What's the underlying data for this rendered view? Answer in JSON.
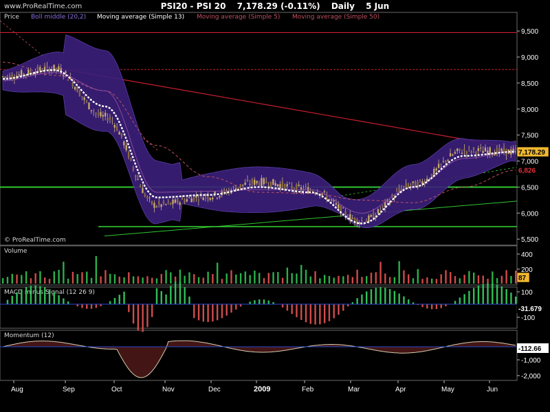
{
  "header": {
    "instrument": "PSI20 - PSI 20",
    "last": "7,178.29 (-0.11%)",
    "period": "Daily",
    "date": "5 Jun"
  },
  "watermark": {
    "top": "www.ProRealTime.com",
    "bottom": "© ProRealTime.com"
  },
  "colors": {
    "price_up": "#2db84a",
    "price_down": "#d34a4a",
    "boll_fill": "#3b1f7a",
    "boll_edge": "#6b4bc2",
    "ma13": "#ffffff",
    "ma5": "#c05060",
    "ma50": "#c05060",
    "horizontal_line": "#cc1f2f",
    "green_line": "#32c832",
    "volume_up": "#2bb04a",
    "volume_down": "#d04a4a",
    "macd_up": "#32c05a",
    "macd_down": "#d24c4c",
    "momentum_pos": "#1f4a17",
    "momentum_neg": "#4a1717",
    "momentum_line": "#d6d0b0",
    "axis_text": "#ffffff",
    "panel_label": "#d8d8d8"
  },
  "chart_data": [
    {
      "panel": "price",
      "type": "line",
      "legend": [
        "Price",
        "Boll middle (20,2)",
        "Moving average (Simple 13)",
        "Moving average (Simple 5)",
        "Moving average (Simple 50)"
      ],
      "x_labels": [
        "Aug",
        "Sep",
        "Oct",
        "Nov",
        "Dec",
        "2009",
        "Feb",
        "Mar",
        "Apr",
        "May",
        "Jun"
      ],
      "y_ticks": [
        "9,500",
        "9,000",
        "8,500",
        "8,000",
        "7,500",
        "7,000",
        "6,500",
        "6,000",
        "5,500"
      ],
      "ylim": [
        5450,
        9700
      ],
      "last_value": "7,178.29",
      "value_labels": [
        "6,826"
      ],
      "x": [
        "Aug",
        "Sep",
        "Oct",
        "Nov",
        "Dec",
        "2009",
        "Feb",
        "Mar",
        "Apr",
        "May",
        "Jun"
      ],
      "series": [
        {
          "name": "Price",
          "values": [
            8620,
            8780,
            7850,
            6150,
            6330,
            6600,
            6450,
            5850,
            6540,
            7200,
            7178
          ]
        },
        {
          "name": "Boll middle (20,2)",
          "values": [
            8550,
            8700,
            8350,
            6400,
            6420,
            6450,
            6450,
            6000,
            6500,
            7050,
            7190
          ]
        },
        {
          "name": "Moving average (Simple 13)",
          "values": [
            8580,
            8750,
            8050,
            6300,
            6350,
            6500,
            6400,
            5800,
            6500,
            7100,
            7180
          ]
        },
        {
          "name": "Moving average (Simple 5)",
          "values": [
            8600,
            8780,
            7700,
            6150,
            6350,
            6550,
            6430,
            5900,
            6550,
            7180,
            7200
          ]
        },
        {
          "name": "Moving average (Simple 50)",
          "values": [
            8900,
            8650,
            8350,
            7300,
            6700,
            6400,
            6380,
            6250,
            6200,
            6500,
            6826
          ]
        }
      ]
    },
    {
      "panel": "volume",
      "type": "bar",
      "label": "Volume",
      "y_ticks": [
        "400",
        "200"
      ],
      "last_value": "87",
      "ylim": [
        0,
        480
      ]
    },
    {
      "panel": "macd",
      "type": "bar",
      "label": "MACD minus Signal (12 26 9)",
      "y_ticks": [
        "100",
        "-100"
      ],
      "last_value": "-31.679",
      "ylim": [
        -160,
        140
      ]
    },
    {
      "panel": "momentum",
      "type": "area",
      "label": "Momentum (12)",
      "y_ticks": [
        "-1,000",
        "-2,000"
      ],
      "last_value": "-112.66",
      "ylim": [
        -2200,
        700
      ]
    }
  ]
}
